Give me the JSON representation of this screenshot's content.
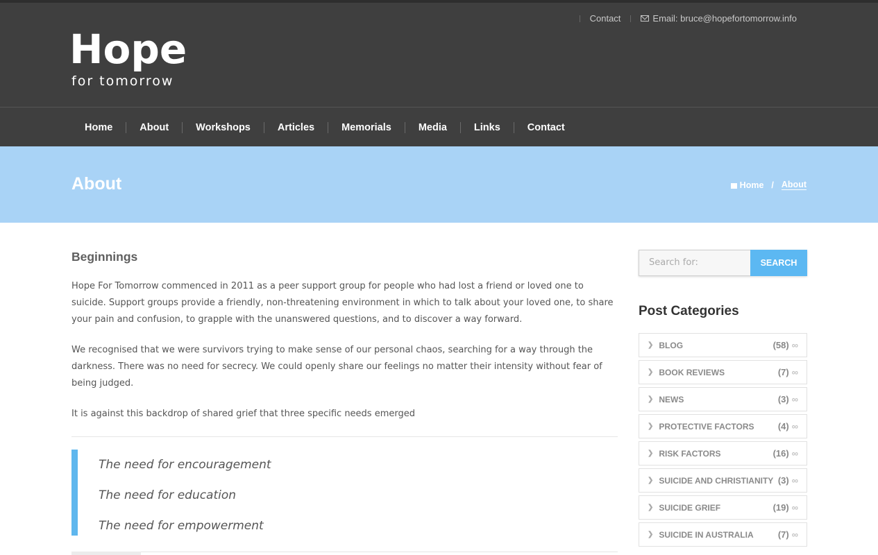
{
  "topbar": {
    "contact": "Contact",
    "email": "Email: bruce@hopefortomorrow.info"
  },
  "logo": {
    "title": "Hope",
    "subtitle": "for tomorrow"
  },
  "nav": [
    "Home",
    "About",
    "Workshops",
    "Articles",
    "Memorials",
    "Media",
    "Links",
    "Contact"
  ],
  "banner": {
    "title": "About",
    "breadcrumb_home": "Home",
    "breadcrumb_sep": "/",
    "breadcrumb_current": "About"
  },
  "content": {
    "heading": "Beginnings",
    "paragraphs": [
      "Hope For Tomorrow commenced in 2011 as a peer support group for people who had lost a friend or loved one to suicide. Support groups provide a friendly, non-threatening environment in which to talk about your loved one, to share your pain and confusion, to grapple with the unanswered questions, and to discover a way forward.",
      "We recognised that we were survivors trying to make sense of our personal chaos, searching for a way through the darkness. There was no need for secrecy. We could openly share our feelings no matter their intensity without fear of being judged.",
      "It is against this backdrop of shared grief that three specific needs emerged"
    ],
    "needs": [
      "The need for encouragement",
      "The need for education",
      "The need for empowerment"
    ]
  },
  "sidebar": {
    "search_placeholder": "Search for:",
    "search_button": "SEARCH",
    "categories_title": "Post Categories",
    "categories": [
      {
        "name": "BLOG",
        "count": "(58)"
      },
      {
        "name": "BOOK REVIEWS",
        "count": "(7)"
      },
      {
        "name": "NEWS",
        "count": "(3)"
      },
      {
        "name": "PROTECTIVE FACTORS",
        "count": "(4)"
      },
      {
        "name": "RISK FACTORS",
        "count": "(16)"
      },
      {
        "name": "SUICIDE AND CHRISTIANITY",
        "count": "(3)"
      },
      {
        "name": "SUICIDE GRIEF",
        "count": "(19)"
      },
      {
        "name": "SUICIDE IN AUSTRALIA",
        "count": "(7)"
      }
    ],
    "rss_glyph": "∞"
  },
  "colors": {
    "header_bg": "#3f3f3f",
    "banner_bg": "#a9d3f6",
    "accent": "#5cb8f2"
  }
}
